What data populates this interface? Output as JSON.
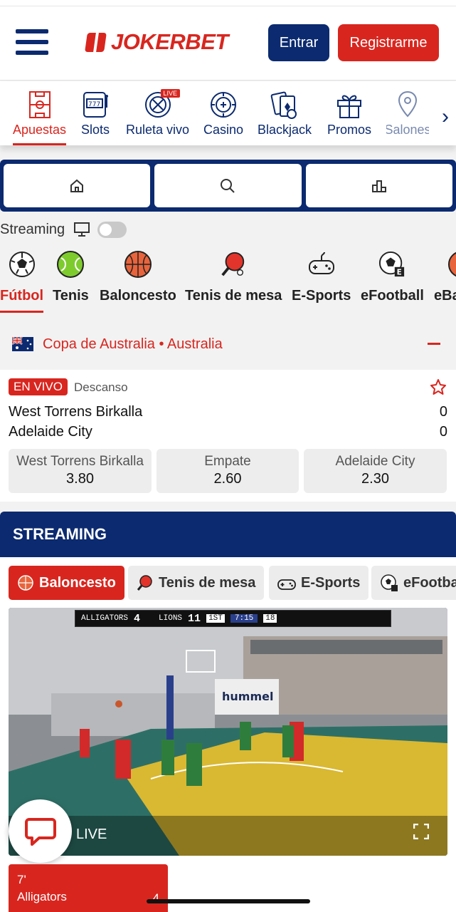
{
  "header": {
    "brand": "JOKERBET",
    "login_label": "Entrar",
    "register_label": "Registrarme"
  },
  "categories": [
    {
      "label": "Apuestas",
      "icon": "pitch-icon",
      "active": true
    },
    {
      "label": "Slots",
      "icon": "slot-machine-icon"
    },
    {
      "label": "Ruleta vivo",
      "icon": "roulette-icon",
      "badge": "LIVE"
    },
    {
      "label": "Casino",
      "icon": "chip-icon"
    },
    {
      "label": "Blackjack",
      "icon": "cards-icon"
    },
    {
      "label": "Promos",
      "icon": "gift-icon"
    },
    {
      "label": "Salones",
      "icon": "location-pin-icon"
    }
  ],
  "tabs": [
    {
      "icon": "home-icon"
    },
    {
      "icon": "search-icon"
    },
    {
      "icon": "podium-icon"
    }
  ],
  "streaming_toggle": {
    "label": "Streaming",
    "on": false
  },
  "sports": [
    {
      "label": "Fútbol",
      "icon": "soccer-ball-icon",
      "active": true
    },
    {
      "label": "Tenis",
      "icon": "tennis-ball-icon"
    },
    {
      "label": "Baloncesto",
      "icon": "basketball-icon"
    },
    {
      "label": "Tenis de mesa",
      "icon": "ping-pong-icon"
    },
    {
      "label": "E-Sports",
      "icon": "gamepad-icon"
    },
    {
      "label": "eFootball",
      "icon": "soccer-ball-e-icon"
    },
    {
      "label": "eBasket",
      "icon": "basketball-icon"
    }
  ],
  "league": {
    "name": "Copa de Australia • Australia"
  },
  "match": {
    "live_label": "EN VIVO",
    "status": "Descanso",
    "home": "West Torrens Birkalla",
    "away": "Adelaide City",
    "home_score": "0",
    "away_score": "0",
    "odds": [
      {
        "name": "West Torrens Birkalla",
        "value": "3.80"
      },
      {
        "name": "Empate",
        "value": "2.60"
      },
      {
        "name": "Adelaide City",
        "value": "2.30"
      }
    ]
  },
  "streaming": {
    "title": "STREAMING",
    "chips": [
      {
        "label": "Baloncesto",
        "icon": "basketball-icon",
        "active": true
      },
      {
        "label": "Tenis de mesa",
        "icon": "ping-pong-icon"
      },
      {
        "label": "E-Sports",
        "icon": "gamepad-icon"
      },
      {
        "label": "eFootball",
        "icon": "soccer-ball-e-icon"
      }
    ],
    "video": {
      "live_label": "LIVE",
      "scoreboard": {
        "home": "ALLIGATORS",
        "home_score": "4",
        "away": "LIONS",
        "away_score": "11",
        "period": "1ST",
        "clock": "7:15",
        "shot": "18"
      }
    },
    "card": {
      "minute": "7'",
      "team": "Alligators",
      "score": "4"
    }
  },
  "colors": {
    "brand_red": "#d8261f",
    "brand_navy": "#0b2a6f"
  }
}
